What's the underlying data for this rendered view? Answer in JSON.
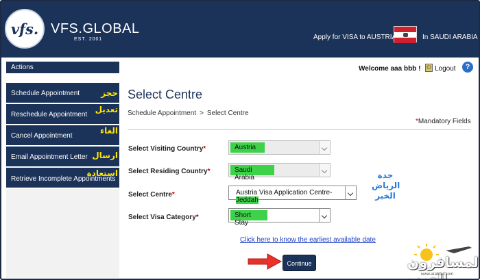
{
  "header": {
    "logo_text": "vfs.",
    "brand": "VFS.GLOBAL",
    "est": "EST. 2001",
    "apply_text": "Apply for VISA to AUSTRIA",
    "country_text": "In SAUDI ARABIA"
  },
  "sidebar": {
    "actions_label": "Actions",
    "items": [
      {
        "label": "Schedule Appointment",
        "arabic": "حجز"
      },
      {
        "label": "Reschedule Appointment",
        "arabic": "تعديل"
      },
      {
        "label": "Cancel Appointment",
        "arabic": "الغاء"
      },
      {
        "label": "Email Appointment Letter",
        "arabic": "ارسال"
      },
      {
        "label": "Retrieve Incomplete Appointments",
        "arabic": "استعادة"
      }
    ]
  },
  "user": {
    "welcome": "Welcome aaa bbb !",
    "logout": "Logout",
    "help": "?"
  },
  "main": {
    "title": "Select Centre",
    "breadcrumb": [
      "Schedule Appointment",
      ">",
      "Select Centre"
    ],
    "mandatory": "Mandatory Fields",
    "fields": [
      {
        "label": "Select Visiting Country",
        "value": "Austria"
      },
      {
        "label": "Select Residing Country",
        "value": "Saudi Arabia"
      },
      {
        "label": "Select Centre",
        "value_prefix": "Austria Visa Application Centre-",
        "value_highlight": "Jeddah"
      },
      {
        "label": "Select Visa Category",
        "value": "Short Stay"
      }
    ],
    "arabic_cities": [
      "جدة",
      "الرياض",
      "الخبر"
    ],
    "earliest_link": "Click here to know the earliest available date",
    "continue_label": "Continue"
  },
  "watermark": {
    "text": "المسافرون العرب",
    "sub": "www.arabovi.com"
  },
  "colors": {
    "navy": "#1b3259",
    "highlight": "#3ed14a",
    "arabic_yellow": "#ffe600",
    "link": "#1a3fc7"
  }
}
